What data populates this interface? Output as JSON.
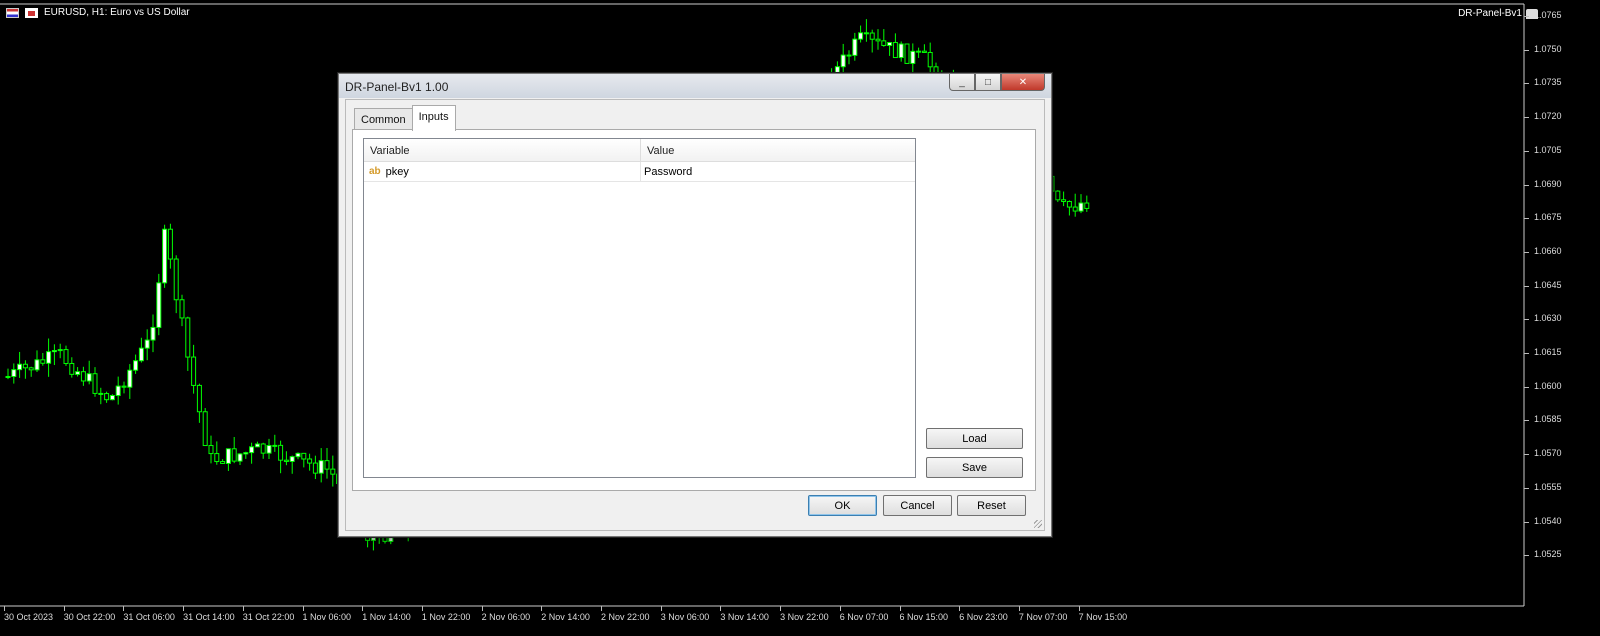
{
  "chart": {
    "symbol_title": "EURUSD, H1:  Euro vs US Dollar",
    "expert_label": "DR-Panel-Bv1",
    "candle_color": "#00ff00",
    "price_levels": [
      "1.0765",
      "1.0750",
      "1.0735",
      "1.0720",
      "1.0705",
      "1.0690",
      "1.0675",
      "1.0660",
      "1.0645",
      "1.0630",
      "1.0615",
      "1.0600",
      "1.0585",
      "1.0570",
      "1.0555",
      "1.0540",
      "1.0525"
    ],
    "time_labels": [
      "30 Oct 2023",
      "30 Oct 22:00",
      "31 Oct 06:00",
      "31 Oct 14:00",
      "31 Oct 22:00",
      "1 Nov 06:00",
      "1 Nov 14:00",
      "1 Nov 22:00",
      "2 Nov 06:00",
      "2 Nov 14:00",
      "2 Nov 22:00",
      "3 Nov 06:00",
      "3 Nov 14:00",
      "3 Nov 22:00",
      "6 Nov 07:00",
      "6 Nov 15:00",
      "6 Nov 23:00",
      "7 Nov 07:00",
      "7 Nov 15:00"
    ]
  },
  "dialog": {
    "title": "DR-Panel-Bv1 1.00",
    "window_buttons": {
      "minimize": "_",
      "maximize": "□",
      "close": "✕"
    },
    "tabs": [
      {
        "label": "Common"
      },
      {
        "label": "Inputs"
      }
    ],
    "grid": {
      "headers": [
        "Variable",
        "Value"
      ],
      "rows": [
        {
          "type_icon": "ab",
          "variable": "pkey",
          "value": "Password"
        }
      ]
    },
    "side_buttons": {
      "load": "Load",
      "save": "Save"
    },
    "buttons": {
      "ok": "OK",
      "cancel": "Cancel",
      "reset": "Reset"
    }
  }
}
